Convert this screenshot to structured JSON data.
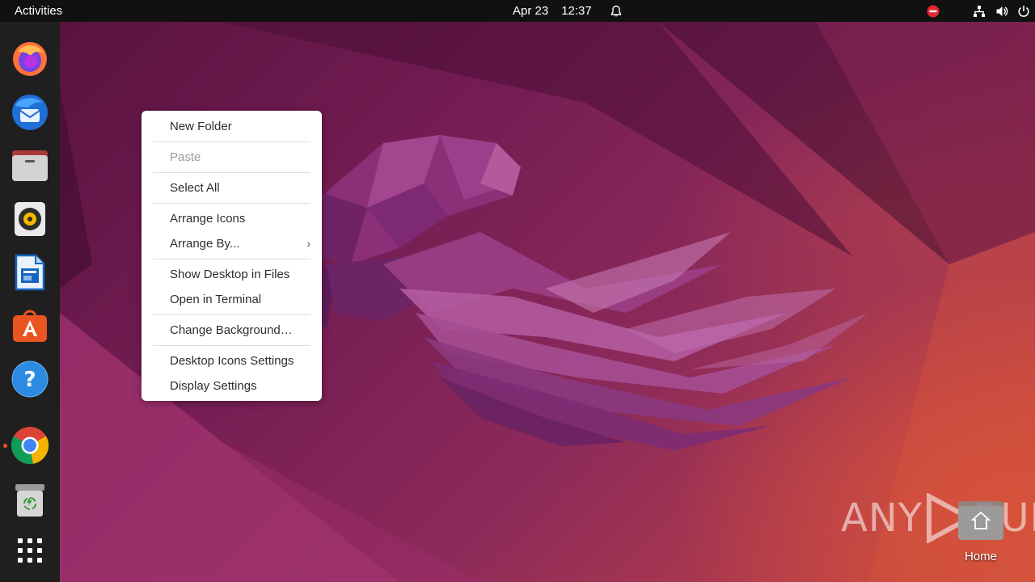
{
  "topbar": {
    "activities_label": "Activities",
    "date": "Apr 23",
    "time": "12:37"
  },
  "dock": {
    "items": [
      {
        "name": "Firefox",
        "icon": "firefox-icon"
      },
      {
        "name": "Thunderbird",
        "icon": "thunderbird-icon"
      },
      {
        "name": "Files",
        "icon": "files-icon"
      },
      {
        "name": "Rhythmbox",
        "icon": "rhythmbox-icon"
      },
      {
        "name": "LibreOffice Writer",
        "icon": "writer-icon"
      },
      {
        "name": "Ubuntu Software",
        "icon": "software-icon"
      },
      {
        "name": "Help",
        "icon": "help-icon"
      },
      {
        "name": "Google Chrome",
        "icon": "chrome-icon",
        "running": true
      },
      {
        "name": "Trash",
        "icon": "trash-icon"
      },
      {
        "name": "Show Applications",
        "icon": "app-grid-icon"
      }
    ]
  },
  "context_menu": {
    "new_folder": "New Folder",
    "paste": "Paste",
    "select_all": "Select All",
    "arrange_icons": "Arrange Icons",
    "arrange_by": "Arrange By...",
    "show_desktop_in_files": "Show Desktop in Files",
    "open_in_terminal": "Open in Terminal",
    "change_background": "Change Background…",
    "desktop_icons_settings": "Desktop Icons Settings",
    "display_settings": "Display Settings"
  },
  "desktop_icons": {
    "home_label": "Home"
  },
  "watermark": {
    "left": "ANY",
    "right": "RUN"
  },
  "colors": {
    "accent": "#e95420",
    "topbar": "#111111",
    "dock": "#1f1f1f",
    "menu_bg": "#ffffff"
  }
}
